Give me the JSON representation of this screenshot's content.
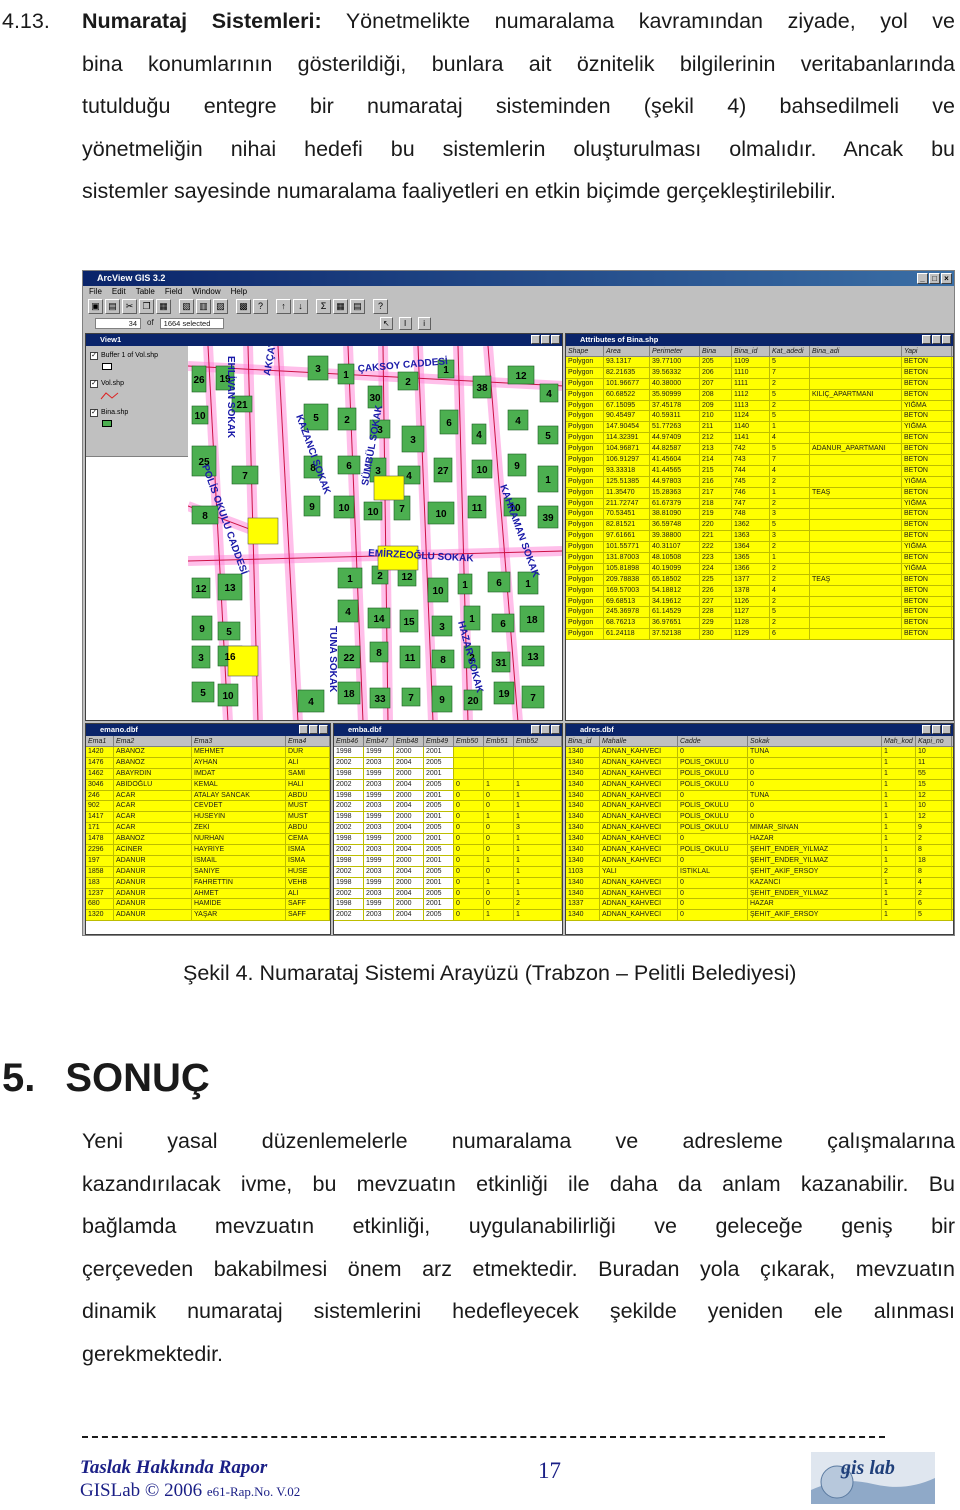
{
  "top_paragraph": {
    "section_number": "4.13.",
    "lead_bold": "Numarataj Sistemleri:",
    "line1_rest": " Yönetmelikte numaralama kavramından ziyade, yol ve",
    "lines": [
      "bina konumlarının gösterildiği, bunlara ait öznitelik bilgilerinin veritabanlarında",
      "tutulduğu entegre bir numarataj sisteminden (şekil 4) bahsedilmeli ve",
      "yönetmeliğin nihai hedefi bu sistemlerin oluşturulması olmalıdır. Ancak bu",
      "sistemler sayesinde numaralama faaliyetleri en etkin biçimde gerçekleştirilebilir."
    ]
  },
  "figure": {
    "app_title": "ArcView GIS 3.2",
    "menu": [
      "File",
      "Edit",
      "Table",
      "Field",
      "Window",
      "Help"
    ],
    "status_count": "34",
    "status_of": "of",
    "status_selected": "1664 selected",
    "view": {
      "title": "View1",
      "layers": [
        "Buffer 1 of Vol.shp",
        "Vol.shp",
        "Bina.shp"
      ],
      "streets": [
        "ÇAKSOY CADDESİ",
        "EHLİVAN SOKAK",
        "AKÇAY SOKAK",
        "KAZANCI SOKAK",
        "SÜMBÜL SOKAK",
        "POLİS OKULU CADDESİ",
        "KAHRAMAN SOKAK",
        "EMİRZEOĞLU SOKAK",
        "TUNA SOKAK",
        "HAZAR SOKAK"
      ],
      "numbers": [
        "26",
        "19",
        "21",
        "10",
        "3",
        "1",
        "30",
        "2",
        "1",
        "38",
        "12",
        "4",
        "5",
        "2",
        "3",
        "3",
        "6",
        "4",
        "4",
        "5",
        "25",
        "7",
        "8",
        "6",
        "3",
        "4",
        "27",
        "10",
        "9",
        "1",
        "8",
        "9",
        "10",
        "10",
        "7",
        "10",
        "11",
        "10",
        "39",
        "1",
        "2",
        "12",
        "10",
        "1",
        "6",
        "1",
        "12",
        "13",
        "9",
        "5",
        "4",
        "14",
        "15",
        "3",
        "1",
        "6",
        "18",
        "3",
        "16",
        "22",
        "8",
        "11",
        "8",
        "2",
        "31",
        "13",
        "5",
        "10",
        "18",
        "33",
        "7",
        "9",
        "20",
        "19",
        "7",
        "4"
      ]
    },
    "attributes": {
      "title": "Attributes of Bina.shp",
      "headers": [
        "Shape",
        "Area",
        "Perimeter",
        "Bina",
        "Bina_id",
        "Kat_adedi",
        "Bina_adi",
        "Yapi"
      ],
      "rows": [
        [
          "Polygon",
          "93.1317",
          "39.77100",
          "205",
          "1109",
          "5",
          "",
          "BETON"
        ],
        [
          "Polygon",
          "82.21635",
          "39.56332",
          "206",
          "1110",
          "7",
          "",
          "BETON"
        ],
        [
          "Polygon",
          "101.96677",
          "40.38000",
          "207",
          "1111",
          "2",
          "",
          "BETON"
        ],
        [
          "Polygon",
          "60.68522",
          "35.90999",
          "208",
          "1112",
          "5",
          "KILIÇ_APARTMANI",
          "BETON"
        ],
        [
          "Polygon",
          "67.15095",
          "37.45178",
          "209",
          "1113",
          "2",
          "",
          "YIĞMA"
        ],
        [
          "Polygon",
          "90.45497",
          "40.59311",
          "210",
          "1124",
          "5",
          "",
          "BETON"
        ],
        [
          "Polygon",
          "147.90454",
          "51.77263",
          "211",
          "1140",
          "1",
          "",
          "YIĞMA"
        ],
        [
          "Polygon",
          "114.32391",
          "44.97409",
          "212",
          "1141",
          "4",
          "",
          "BETON"
        ],
        [
          "Polygon",
          "104.96871",
          "44.82587",
          "213",
          "742",
          "5",
          "ADANUR_APARTMANI",
          "BETON"
        ],
        [
          "Polygon",
          "106.91297",
          "41.45604",
          "214",
          "743",
          "7",
          "",
          "BETON"
        ],
        [
          "Polygon",
          "93.33318",
          "41.44565",
          "215",
          "744",
          "4",
          "",
          "BETON"
        ],
        [
          "Polygon",
          "125.51385",
          "44.97803",
          "216",
          "745",
          "2",
          "",
          "YIĞMA"
        ],
        [
          "Polygon",
          "11.35470",
          "15.28363",
          "217",
          "746",
          "1",
          "TEAŞ",
          "BETON"
        ],
        [
          "Polygon",
          "211.72747",
          "61.67379",
          "218",
          "747",
          "2",
          "",
          "YIĞMA"
        ],
        [
          "Polygon",
          "70.53451",
          "38.81090",
          "219",
          "748",
          "3",
          "",
          "BETON"
        ],
        [
          "Polygon",
          "82.81521",
          "36.59748",
          "220",
          "1362",
          "5",
          "",
          "BETON"
        ],
        [
          "Polygon",
          "97.61661",
          "39.38800",
          "221",
          "1363",
          "3",
          "",
          "BETON"
        ],
        [
          "Polygon",
          "101.55771",
          "40.31107",
          "222",
          "1364",
          "2",
          "",
          "YIĞMA"
        ],
        [
          "Polygon",
          "131.87003",
          "48.10508",
          "223",
          "1365",
          "1",
          "",
          "BETON"
        ],
        [
          "Polygon",
          "105.81898",
          "40.19099",
          "224",
          "1366",
          "2",
          "",
          "YIĞMA"
        ],
        [
          "Polygon",
          "209.78838",
          "65.18502",
          "225",
          "1377",
          "2",
          "TEAŞ",
          "BETON"
        ],
        [
          "Polygon",
          "169.57003",
          "54.18812",
          "226",
          "1378",
          "4",
          "",
          "BETON"
        ],
        [
          "Polygon",
          "69.68513",
          "34.19612",
          "227",
          "1126",
          "2",
          "",
          "BETON"
        ],
        [
          "Polygon",
          "245.36978",
          "61.14529",
          "228",
          "1127",
          "5",
          "",
          "BETON"
        ],
        [
          "Polygon",
          "68.76213",
          "36.97651",
          "229",
          "1128",
          "2",
          "",
          "BETON"
        ],
        [
          "Polygon",
          "61.24118",
          "37.52138",
          "230",
          "1129",
          "6",
          "",
          "BETON"
        ]
      ]
    },
    "emano": {
      "title": "emano.dbf",
      "headers": [
        "Ema1",
        "Ema2",
        "Ema3",
        "Ema4"
      ],
      "rows": [
        [
          "1420",
          "ABANOZ",
          "MEHMET",
          "DUR"
        ],
        [
          "1476",
          "ABANOZ",
          "AYHAN",
          "ALİ"
        ],
        [
          "1462",
          "ABAYRDIN",
          "İMDAT",
          "SAMİ"
        ],
        [
          "3046",
          "ABİDOĞLU",
          "KEMAL",
          "HALİ"
        ],
        [
          "246",
          "ACAR",
          "ATALAY SANCAK",
          "ABDU"
        ],
        [
          "902",
          "ACAR",
          "CEVDET",
          "MUST"
        ],
        [
          "1417",
          "ACAR",
          "HÜSEYİN",
          "MUST"
        ],
        [
          "171",
          "ACAR",
          "ZEKİ",
          "ABDU"
        ],
        [
          "1478",
          "ABANOZ",
          "NURHAN",
          "CEMA"
        ],
        [
          "2296",
          "ACİNER",
          "HAYRİYE",
          "İSMA"
        ],
        [
          "197",
          "ADANUR",
          "İSMAİL",
          "İSMA"
        ],
        [
          "1858",
          "ADANUR",
          "SANİYE",
          "HÜSE"
        ],
        [
          "183",
          "ADANUR",
          "FAHRETTİN",
          "VEHB"
        ],
        [
          "1237",
          "ADANUR",
          "AHMET",
          "ALİ"
        ],
        [
          "680",
          "ADANUR",
          "HAMİDE",
          "SAFF"
        ],
        [
          "1320",
          "ADANUR",
          "YAŞAR",
          "SAFF"
        ]
      ]
    },
    "emba": {
      "title": "emba.dbf",
      "headers": [
        "Emb46",
        "Emb47",
        "Emb48",
        "Emb49",
        "Emb50",
        "Emb51",
        "Emb52"
      ],
      "rows": [
        [
          "1998",
          "1999",
          "2000",
          "2001",
          "",
          "",
          ""
        ],
        [
          "2002",
          "2003",
          "2004",
          "2005",
          "",
          "",
          ""
        ],
        [
          "1998",
          "1999",
          "2000",
          "2001",
          "",
          "",
          ""
        ],
        [
          "2002",
          "2003",
          "2004",
          "2005",
          "0",
          "1",
          "1"
        ],
        [
          "1998",
          "1999",
          "2000",
          "2001",
          "0",
          "0",
          "1"
        ],
        [
          "2002",
          "2003",
          "2004",
          "2005",
          "0",
          "0",
          "1"
        ],
        [
          "1998",
          "1999",
          "2000",
          "2001",
          "0",
          "1",
          "1"
        ],
        [
          "2002",
          "2003",
          "2004",
          "2005",
          "0",
          "0",
          "3"
        ],
        [
          "1998",
          "1999",
          "2000",
          "2001",
          "0",
          "0",
          "1"
        ],
        [
          "2002",
          "2003",
          "2004",
          "2005",
          "0",
          "0",
          "1"
        ],
        [
          "1998",
          "1999",
          "2000",
          "2001",
          "0",
          "1",
          "1"
        ],
        [
          "2002",
          "2003",
          "2004",
          "2005",
          "0",
          "0",
          "1"
        ],
        [
          "1998",
          "1999",
          "2000",
          "2001",
          "0",
          "1",
          "1"
        ],
        [
          "2002",
          "2003",
          "2004",
          "2005",
          "0",
          "0",
          "1"
        ],
        [
          "1998",
          "1999",
          "2000",
          "2001",
          "0",
          "0",
          "2"
        ],
        [
          "2002",
          "2003",
          "2004",
          "2005",
          "0",
          "1",
          "1"
        ]
      ]
    },
    "adres": {
      "title": "adres.dbf",
      "headers": [
        "Bina_id",
        "Mahalle",
        "Cadde",
        "Sokak",
        "Mah_kod",
        "Kapi_no"
      ],
      "rows": [
        [
          "1340",
          "ADNAN_KAHVECİ",
          "0",
          "TUNA",
          "1",
          "10"
        ],
        [
          "1340",
          "ADNAN_KAHVECİ",
          "POLİS_OKULU",
          "0",
          "1",
          "11"
        ],
        [
          "1340",
          "ADNAN_KAHVECİ",
          "POLİS_OKULU",
          "0",
          "1",
          "55"
        ],
        [
          "1340",
          "ADNAN_KAHVECİ",
          "POLİS_OKULU",
          "0",
          "1",
          "15"
        ],
        [
          "1340",
          "ADNAN_KAHVECİ",
          "0",
          "TUNA",
          "1",
          "12"
        ],
        [
          "1340",
          "ADNAN_KAHVECİ",
          "POLİS_OKULU",
          "0",
          "1",
          "10"
        ],
        [
          "1340",
          "ADNAN_KAHVECİ",
          "POLİS_OKULU",
          "0",
          "1",
          "12"
        ],
        [
          "1340",
          "ADNAN_KAHVECİ",
          "POLİS_OKULU",
          "MİMAR_SİNAN",
          "1",
          "9"
        ],
        [
          "1340",
          "ADNAN_KAHVECİ",
          "0",
          "HAZAR",
          "1",
          "2"
        ],
        [
          "1340",
          "ADNAN_KAHVECİ",
          "POLİS_OKULU",
          "ŞEHİT_ENDER_YILMAZ",
          "1",
          "8"
        ],
        [
          "1340",
          "ADNAN_KAHVECİ",
          "0",
          "ŞEHİT_ENDER_YILMAZ",
          "1",
          "18"
        ],
        [
          "1103",
          "YALI",
          "İSTİKLAL",
          "ŞEHİT_AKİF_ERSOY",
          "2",
          "8"
        ],
        [
          "1340",
          "ADNAN_KAHVECİ",
          "0",
          "KAZANCI",
          "1",
          "4"
        ],
        [
          "1340",
          "ADNAN_KAHVECİ",
          "0",
          "ŞEHİT_ENDER_YILMAZ",
          "1",
          "2"
        ],
        [
          "1337",
          "ADNAN_KAHVECİ",
          "0",
          "HAZAR",
          "1",
          "6"
        ],
        [
          "1340",
          "ADNAN_KAHVECİ",
          "0",
          "ŞEHİT_AKİF_ERSOY",
          "1",
          "5"
        ]
      ]
    }
  },
  "caption": "Şekil 4. Numarataj Sistemi Arayüzü (Trabzon – Pelitli Belediyesi)",
  "section": {
    "number": "5.",
    "title": "SONUÇ"
  },
  "conclusion_lines": [
    "Yeni yasal düzenlemelerle numaralama ve adresleme çalışmalarına",
    "kazandırılacak ivme, bu mevzuatın etkinliği ile daha da anlam kazanabilir. Bu",
    "bağlamda mevzuatın etkinliği, uygulanabilirliği ve geleceğe geniş bir",
    "çerçeveden bakabilmesi önem arz etmektedir. Buradan yola çıkarak, mevzuatın",
    "dinamik numarataj sistemlerini hedefleyecek şekilde yeniden ele alınması",
    "gerekmektedir."
  ],
  "footer": {
    "title": "Taslak Hakkında Rapor",
    "org": "GISLab © 2006",
    "doc_no": "e61-Rap.No. V.02",
    "page_number": "17",
    "logo_text": "gis lab"
  },
  "colors": {
    "text": "#1a1a1a",
    "footer": "#1a1f86",
    "selection": "#ffff00",
    "building": "#4caf50",
    "titlebar": "#0a246a"
  }
}
